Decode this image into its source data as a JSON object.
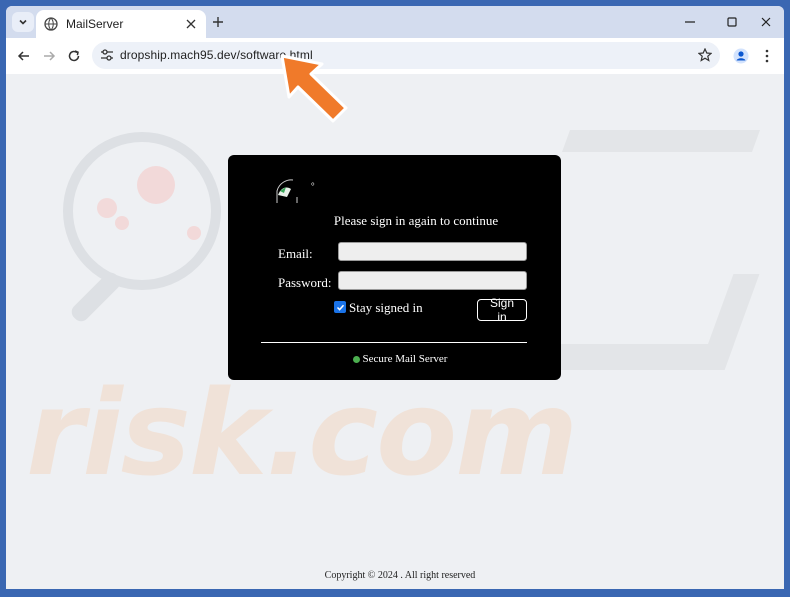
{
  "browser": {
    "tab_title": "MailServer",
    "url": "dropship.mach95.dev/software.html"
  },
  "login": {
    "heading": "Please sign in again to continue",
    "email_label": "Email:",
    "password_label": "Password:",
    "email_value": "",
    "password_value": "",
    "stay_signed_in_label": "Stay signed in",
    "stay_signed_in_checked": true,
    "signin_button": "Sign in",
    "secure_text": "Secure Mail Server",
    "logo_mark": "°"
  },
  "footer": {
    "copyright": "Copyright © 2024 . All right reserved"
  },
  "watermark": {
    "text": "risk.com"
  },
  "colors": {
    "frame": "#3a67b2",
    "card": "#000000",
    "checkbox": "#1a73e8",
    "secure_dot": "#4caf50",
    "arrow": "#f07a2a"
  }
}
